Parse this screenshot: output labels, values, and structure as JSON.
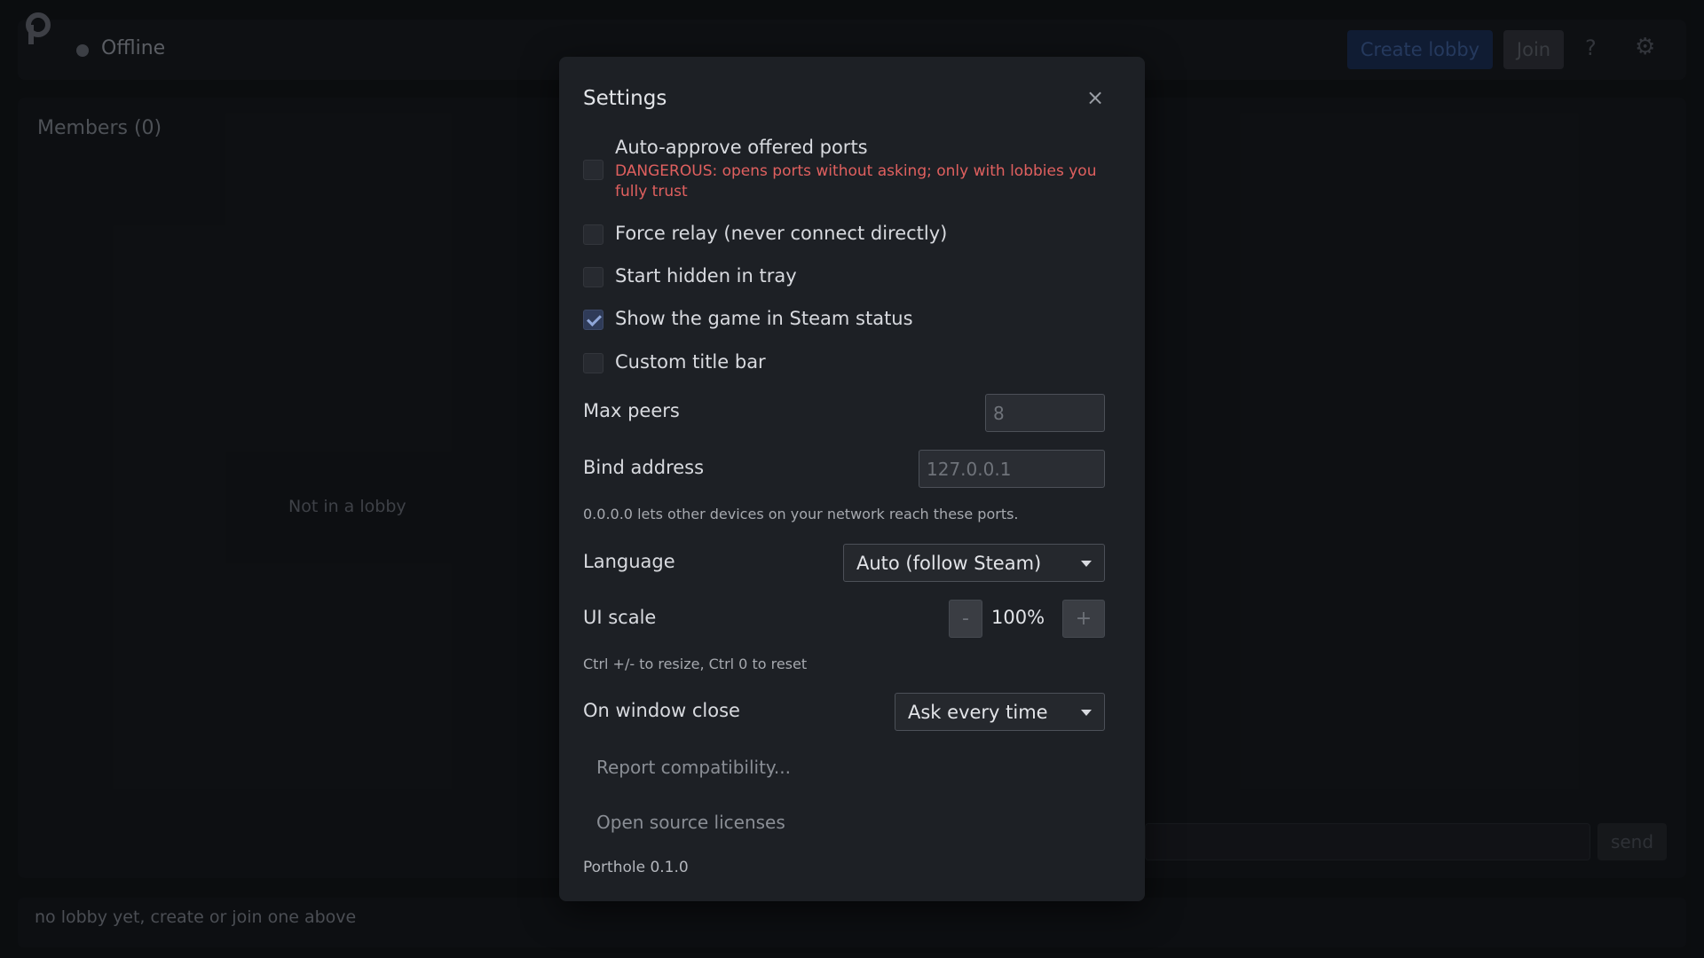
{
  "app": {
    "status": "Offline",
    "create_lobby": "Create lobby",
    "join": "Join",
    "help": "?",
    "gear": "⚙",
    "members_title": "Members (0)",
    "empty": "Not in a lobby",
    "send": "send",
    "footer": "no lobby yet, create or join one above"
  },
  "settings": {
    "title": "Settings",
    "close": "×",
    "options": [
      {
        "label": "Auto-approve offered ports",
        "checked": false
      },
      {
        "label": "Force relay (never connect directly)",
        "checked": false
      },
      {
        "label": "Start hidden in tray",
        "checked": false
      },
      {
        "label": "Show the game in Steam status",
        "checked": true
      },
      {
        "label": "Custom title bar",
        "checked": false
      }
    ],
    "danger_warning": "DANGEROUS: opens ports without asking; only with lobbies you fully trust",
    "max_peers": {
      "label": "Max peers",
      "placeholder": "8"
    },
    "bind_address": {
      "label": "Bind address",
      "placeholder": "127.0.0.1",
      "hint": "0.0.0.0 lets other devices on your network reach these ports."
    },
    "language": {
      "label": "Language",
      "value": "Auto (follow Steam)"
    },
    "ui_scale": {
      "label": "UI scale",
      "minus": "-",
      "value": "100%",
      "plus": "+",
      "hint": "Ctrl +/- to resize, Ctrl 0 to reset"
    },
    "on_close": {
      "label": "On window close",
      "value": "Ask every time"
    },
    "report": "Report compatibility...",
    "licenses": "Open source licenses",
    "version": "Porthole 0.1.0"
  },
  "colors": {
    "background": "#0e1013",
    "modal": "#1d2025",
    "danger": "#e0605f",
    "accent": "#2f3b58"
  }
}
